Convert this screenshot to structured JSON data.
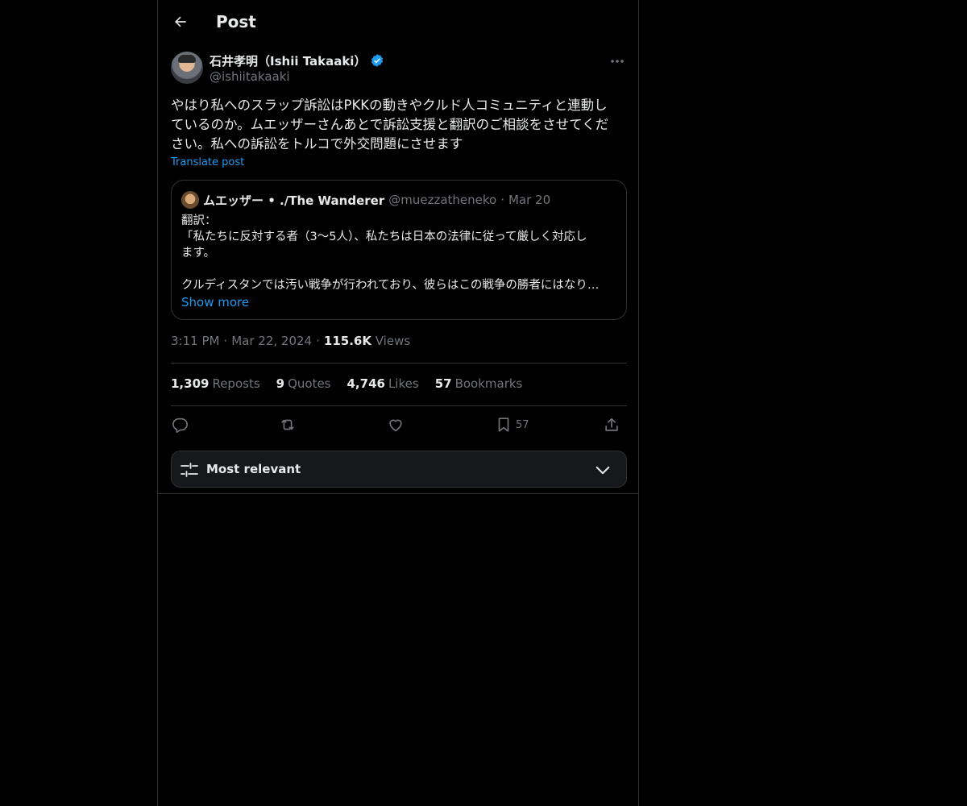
{
  "header": {
    "title": "Post"
  },
  "author": {
    "name": "石井孝明（Ishii Takaaki）",
    "handle": "@ishiitakaaki"
  },
  "tweet": {
    "lines": [
      "やはり私へのスラップ訴訟はPKKの動きやクルド人コミュニティと連動し",
      "ているのか。ムエッザーさんあとで訴訟支援と翻訳のご相談をさせてくだ",
      "さい。私への訴訟をトルコで外交問題にさせます"
    ],
    "translate_label": "Translate post"
  },
  "quote": {
    "name": "ムエッザー • ./The Wanderer",
    "handle": "@muezzatheneko",
    "date": "Mar 20",
    "lines": [
      "翻訳：",
      "「私たちに反対する者（3〜5人）、私たちは日本の法律に従って厳しく対応し",
      "ます。",
      "",
      "クルディスタンでは汚い戦争が行われており、彼らはこの戦争の勝者にはなり…"
    ],
    "show_more": "Show more"
  },
  "meta": {
    "time": "3:11 PM",
    "date": "Mar 22, 2024",
    "views_count": "115.6K",
    "views_label": "Views"
  },
  "stats": [
    {
      "count": "1,309",
      "label": "Reposts"
    },
    {
      "count": "9",
      "label": "Quotes"
    },
    {
      "count": "4,746",
      "label": "Likes"
    },
    {
      "count": "57",
      "label": "Bookmarks"
    }
  ],
  "actions": {
    "bookmark_count": "57"
  },
  "sort": {
    "label": "Most relevant"
  },
  "colors": {
    "accent": "#1d9bf0",
    "border": "#2f3336",
    "muted": "#71767b",
    "text": "#e7e9ea"
  }
}
